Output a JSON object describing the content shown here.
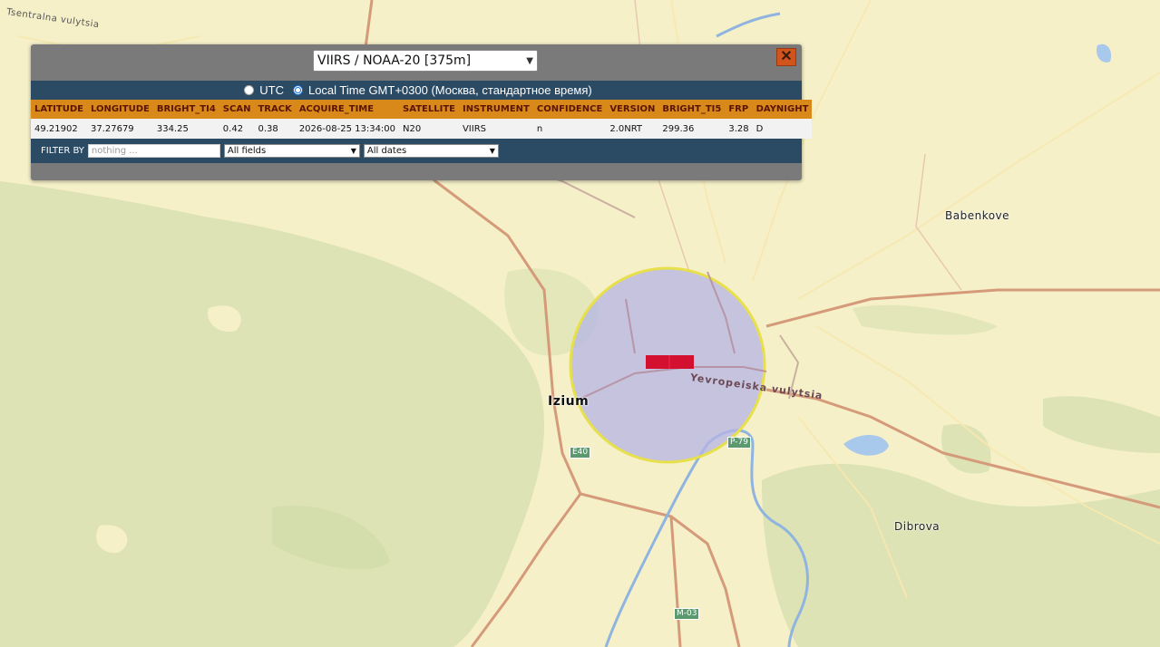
{
  "popup": {
    "dataset_selected": "VIIRS / NOAA-20 [375m]",
    "close_glyph": "✕",
    "timezone": {
      "utc_label": "UTC",
      "local_label": "Local Time GMT+0300 (Москва, стандартное время)",
      "selected": "local"
    },
    "table": {
      "headers": [
        "LATITUDE",
        "LONGITUDE",
        "BRIGHT_TI4",
        "SCAN",
        "TRACK",
        "ACQUIRE_TIME",
        "SATELLITE",
        "INSTRUMENT",
        "CONFIDENCE",
        "VERSION",
        "BRIGHT_TI5",
        "FRP",
        "DAYNIGHT"
      ],
      "rows": [
        [
          "49.21902",
          "37.27679",
          "334.25",
          "0.42",
          "0.38",
          "2026-08-25 13:34:00",
          "N20",
          "VIIRS",
          "n",
          "2.0NRT",
          "299.36",
          "3.28",
          "D"
        ]
      ]
    },
    "filter": {
      "label": "FILTER BY",
      "placeholder": "nothing ...",
      "field_selected": "All fields",
      "date_selected": "All dates"
    }
  },
  "map": {
    "labels": {
      "street_top": "Tsentralna vulytsia",
      "babenkove": "Babenkove",
      "izium": "Izium",
      "yevropeiska": "Yevropeiska vulytsia",
      "dibrova": "Dibrova"
    },
    "shields": {
      "e40": "E40",
      "p79": "P-79",
      "m03": "M-03"
    }
  },
  "colors": {
    "header_bg": "#d9891a",
    "bar_bg": "#2b4a63",
    "popup_bg": "#7a7a7a",
    "fire_pixel": "#d41030",
    "circle_fill": "#b4b4e6",
    "circle_stroke": "#e8e04a"
  }
}
